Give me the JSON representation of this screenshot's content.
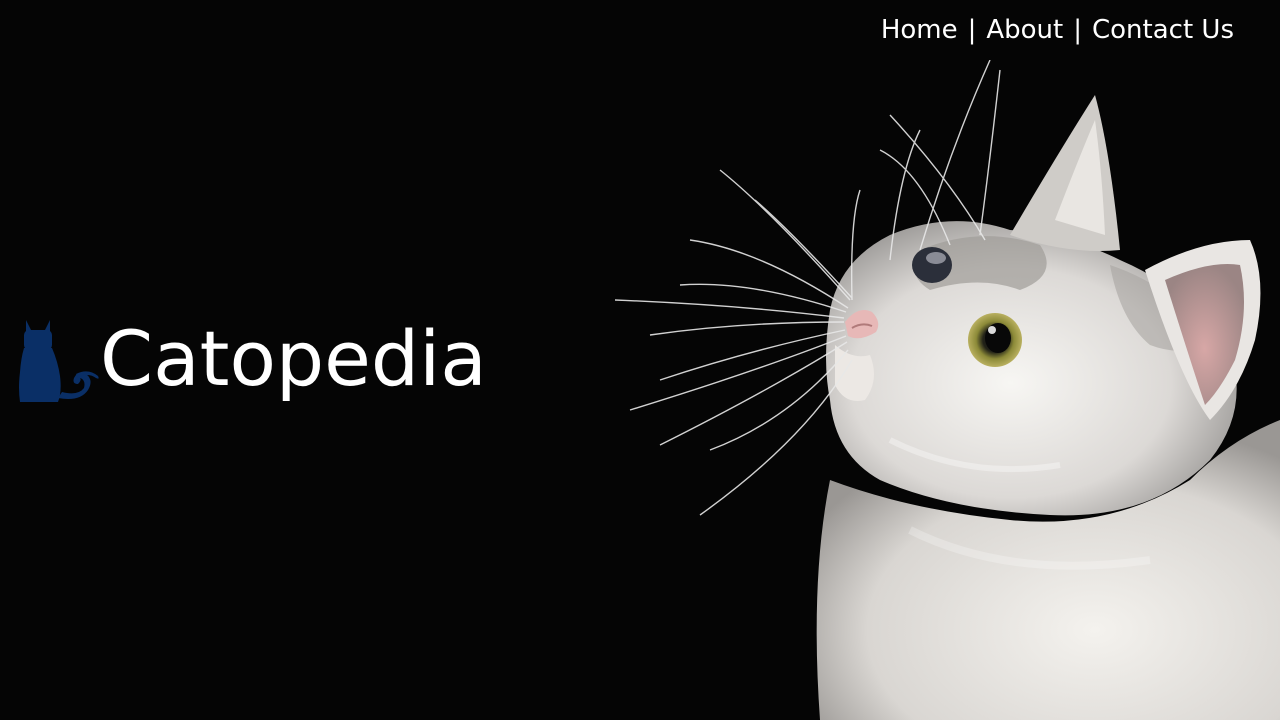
{
  "nav": {
    "items": [
      {
        "label": "Home"
      },
      {
        "label": "About"
      },
      {
        "label": "Contact Us"
      }
    ],
    "separator": "|"
  },
  "brand": {
    "name": "Catopedia",
    "logo_icon": "cat-silhouette-icon",
    "logo_color": "#0a2f66"
  },
  "hero": {
    "photo": "white-kitten-photo"
  },
  "colors": {
    "background": "#050505",
    "text": "#ffffff"
  }
}
